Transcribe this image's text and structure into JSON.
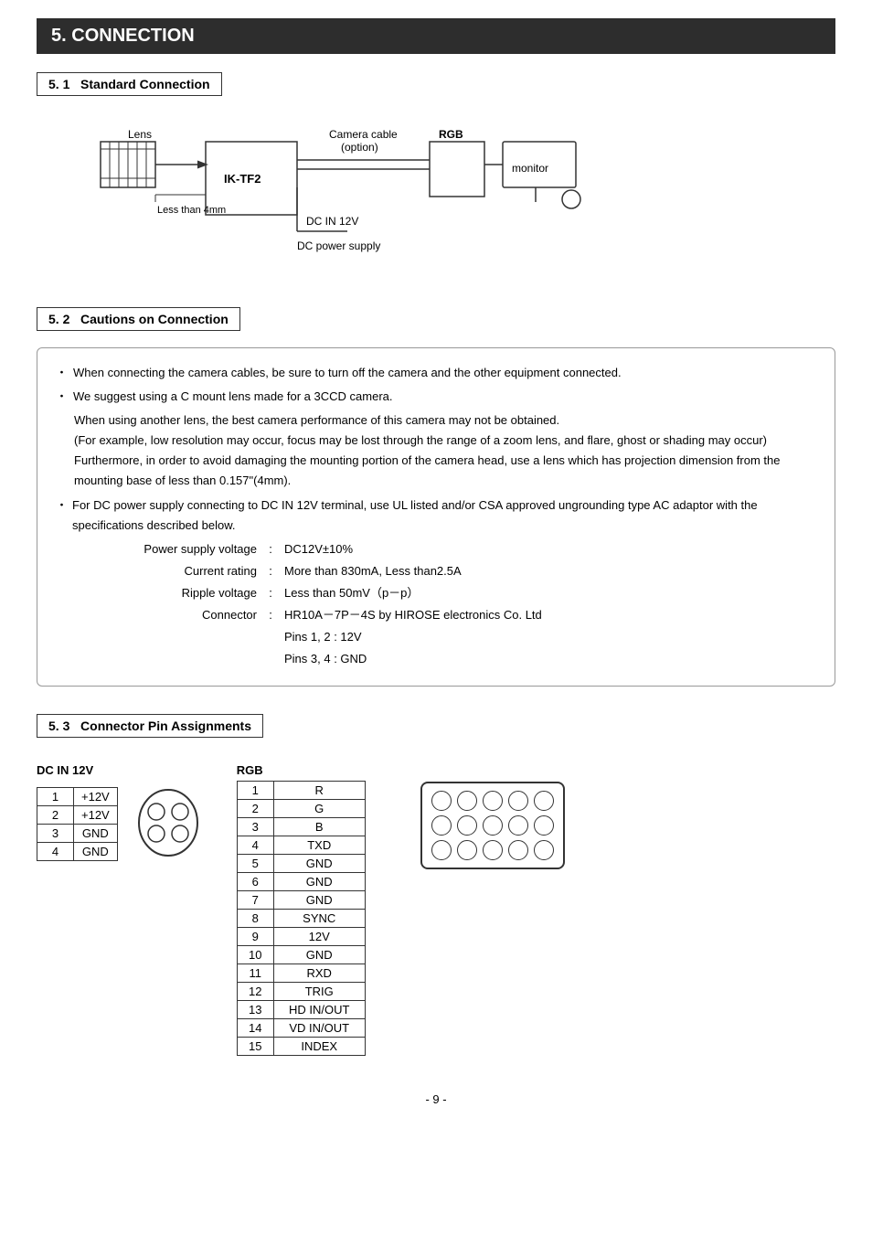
{
  "page": {
    "section_number": "5.",
    "section_title": "CONNECTION",
    "subsections": [
      {
        "number": "5. 1",
        "title": "Standard Connection"
      },
      {
        "number": "5. 2",
        "title": "Cautions on Connection"
      },
      {
        "number": "5. 3",
        "title": "Connector Pin Assignments"
      }
    ]
  },
  "diagram": {
    "lens_label": "Lens",
    "camera_label": "IK-TF2",
    "camera_cable_label": "Camera cable",
    "camera_cable_sub": "(option)",
    "rgb_label": "RGB",
    "monitor_label": "monitor",
    "dc_in_label": "DC IN 12V",
    "dc_power_label": "DC power supply",
    "less_than_label": "Less than 4mm"
  },
  "cautions": {
    "items": [
      {
        "bullet": "・",
        "text": "When connecting the camera cables, be sure to turn off the camera and the other equipment connected."
      },
      {
        "bullet": "・",
        "text": "We suggest using a C mount lens made for a 3CCD camera."
      }
    ],
    "indent_lines": [
      "When using another lens, the best camera performance of this camera may not be obtained.",
      "(For example, low resolution may occur, focus may be lost through the range of a zoom lens, and flare, ghost or shading may occur)",
      "Furthermore, in order to avoid damaging the mounting portion of the camera head, use a lens which has projection dimension from the mounting base of less than 0.157\"(4mm)."
    ],
    "dc_bullet": "・",
    "dc_text": "For DC power supply connecting to DC IN 12V terminal, use UL listed and/or CSA approved ungrounding type AC adaptor with the specifications described below.",
    "specs": [
      {
        "label": "Power supply voltage",
        "value": "DC12V±10%"
      },
      {
        "label": "Current rating",
        "value": "More than 830mA, Less than2.5A"
      },
      {
        "label": "Ripple voltage",
        "value": "Less than 50mV（p－p）"
      },
      {
        "label": "Connector",
        "value": "HR10A－7P－4S by HIROSE electronics Co. Ltd"
      },
      {
        "label": "",
        "value": "Pins 1, 2  :  12V"
      },
      {
        "label": "",
        "value": "Pins 3, 4  :  GND"
      }
    ]
  },
  "dc_pin": {
    "label": "DC IN 12V",
    "rows": [
      {
        "pin": "1",
        "signal": "+12V"
      },
      {
        "pin": "2",
        "signal": "+12V"
      },
      {
        "pin": "3",
        "signal": "GND"
      },
      {
        "pin": "4",
        "signal": "GND"
      }
    ]
  },
  "rgb_pin": {
    "label": "RGB",
    "rows": [
      {
        "pin": "1",
        "signal": "R"
      },
      {
        "pin": "2",
        "signal": "G"
      },
      {
        "pin": "3",
        "signal": "B"
      },
      {
        "pin": "4",
        "signal": "TXD"
      },
      {
        "pin": "5",
        "signal": "GND"
      },
      {
        "pin": "6",
        "signal": "GND"
      },
      {
        "pin": "7",
        "signal": "GND"
      },
      {
        "pin": "8",
        "signal": "SYNC"
      },
      {
        "pin": "9",
        "signal": "12V"
      },
      {
        "pin": "10",
        "signal": "GND"
      },
      {
        "pin": "11",
        "signal": "RXD"
      },
      {
        "pin": "12",
        "signal": "TRIG"
      },
      {
        "pin": "13",
        "signal": "HD IN/OUT"
      },
      {
        "pin": "14",
        "signal": "VD IN/OUT"
      },
      {
        "pin": "15",
        "signal": "INDEX"
      }
    ]
  },
  "page_number": "- 9 -"
}
